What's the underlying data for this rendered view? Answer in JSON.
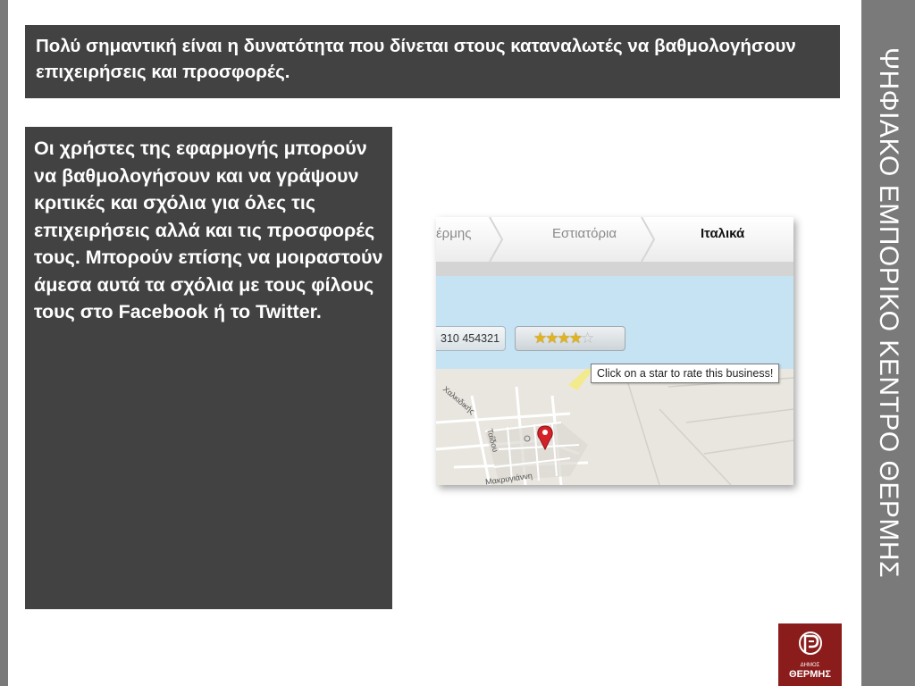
{
  "slide": {
    "side_title": "ΨΗΦΙΑΚΟ ΕΜΠΟΡΙΚΟ ΚΕΝΤΡΟ ΘΕΡΜΗΣ",
    "headline": "Πολύ σημαντική είναι η δυνατότητα που δίνεται στους καταναλωτές να βαθμολογήσουν επιχειρήσεις και προσφορές.",
    "body_text": "Οι χρήστες της εφαρμογής μπορούν να βαθμολογήσουν και να γράψουν κριτικές και σχόλια για όλες τις επιχειρήσεις αλλά και τις προσφορές τους. Μπορούν επίσης να μοιραστούν άμεσα αυτά τα σχόλια με τους φίλους τους στο Facebook ή το Twitter."
  },
  "screenshot": {
    "breadcrumbs": [
      "έρμης",
      "Εστιατόρια",
      "Ιταλικά"
    ],
    "phone": "310 454321",
    "rating": {
      "filled": 4,
      "total": 5
    },
    "tooltip": "Click on a star to rate this business!",
    "map_labels": [
      "Χαλκιδικής",
      "Ταΐδου",
      "Μακρυγιάννη"
    ],
    "pin_color": "#d42027"
  },
  "logo": {
    "line_small": "ΔΗΜΟΣ",
    "line_big": "ΘΕΡΜΗΣ",
    "color": "#8b1c1c"
  }
}
